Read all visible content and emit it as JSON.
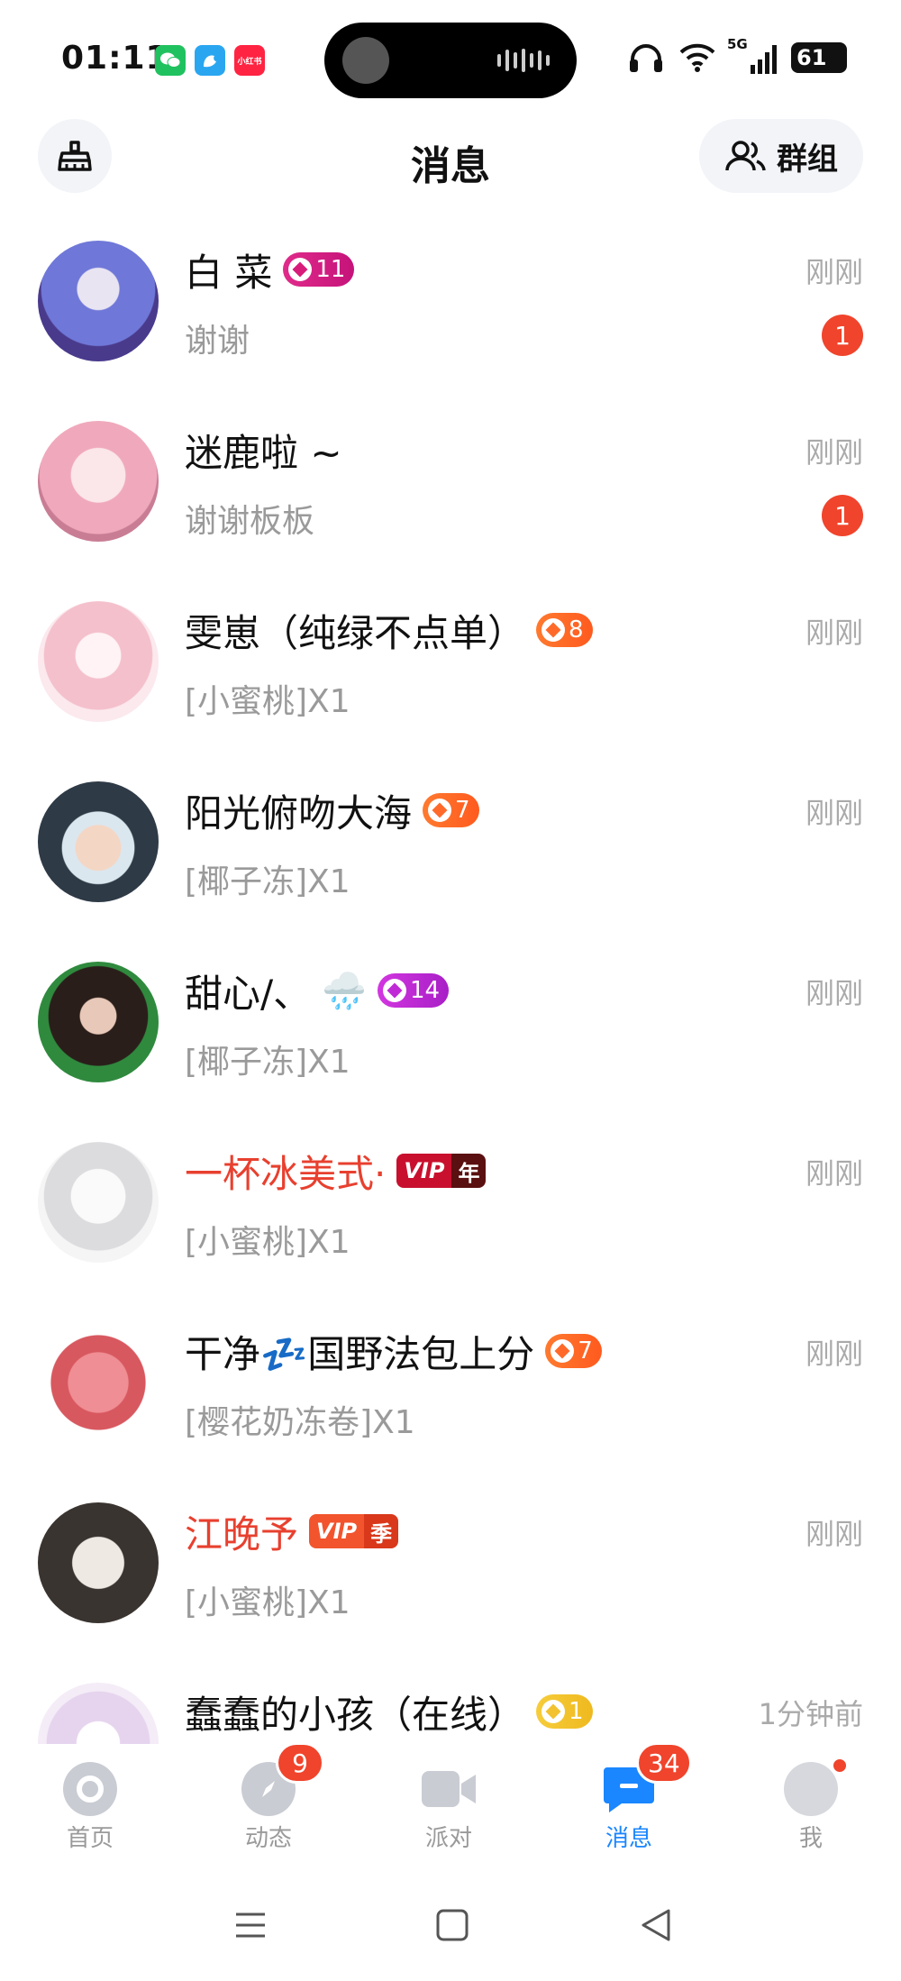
{
  "status_bar": {
    "time": "01:11",
    "apps": [
      {
        "icon": "wechat-icon",
        "color": "#20c25f"
      },
      {
        "icon": "bird-app-icon",
        "color": "#2aa6f0"
      },
      {
        "icon": "xiaohongshu-icon",
        "color": "#ff2442",
        "label": "小红书"
      }
    ],
    "network": "5G",
    "battery": "61"
  },
  "header": {
    "title": "消息",
    "group_label": "群组"
  },
  "conversations": [
    {
      "name": "白 菜",
      "level": "11",
      "level_color": "#d81b7a",
      "preview": "谢谢",
      "time": "刚刚",
      "unread": "1",
      "avatar_color": "#5a74d6"
    },
    {
      "name": "迷鹿啦 ~",
      "preview": "谢谢板板",
      "time": "刚刚",
      "unread": "1",
      "avatar_color": "#f2b9c8"
    },
    {
      "name": "雯崽（纯绿不点单）",
      "level": "8",
      "level_color": "#ff6a2a",
      "preview": "[小蜜桃]X1",
      "time": "刚刚",
      "avatar_color": "#f7d7de"
    },
    {
      "name": "阳光俯吻大海",
      "level": "7",
      "level_color": "#ff6a2a",
      "preview": "[椰子冻]X1",
      "time": "刚刚",
      "avatar_color": "#3a4a5a"
    },
    {
      "name": "甜心/、",
      "emoji": "🌧️",
      "level": "14",
      "level_color": "#c02ad6",
      "preview": "[椰子冻]X1",
      "time": "刚刚",
      "avatar_color": "#2f7a3a"
    },
    {
      "name": "一杯冰美式·",
      "vip": "VIP",
      "vip_term": "年",
      "vip_color": "#c8102e",
      "vip_term_color": "#5a1010",
      "preview": "[小蜜桃]X1",
      "time": "刚刚",
      "avatar_color": "#e9e9ea"
    },
    {
      "name": "干净💤国野法包上分",
      "level": "7",
      "level_color": "#ff6a2a",
      "preview": "[樱花奶冻卷]X1",
      "time": "刚刚",
      "avatar_color": "#e5737a"
    },
    {
      "name": "江晚予",
      "vip": "VIP",
      "vip_term": "季",
      "vip_color": "#f2542d",
      "vip_term_color": "#d9381b",
      "preview": "[小蜜桃]X1",
      "time": "刚刚",
      "avatar_color": "#3b3b3b"
    },
    {
      "name": "蠢蠢的小孩（在线）",
      "level": "1",
      "level_color": "#f2c230",
      "preview": "",
      "time": "1分钟前",
      "avatar_color": "#efe3f3"
    }
  ],
  "tabs": [
    {
      "label": "首页",
      "icon": "home-icon"
    },
    {
      "label": "动态",
      "icon": "compass-icon",
      "badge": "9"
    },
    {
      "label": "派对",
      "icon": "video-icon"
    },
    {
      "label": "消息",
      "icon": "message-icon",
      "badge": "34",
      "active": true
    },
    {
      "label": "我",
      "icon": "profile-icon",
      "dot": true
    }
  ],
  "colors": {
    "accent": "#1a86ff",
    "badge_red": "#f0442c",
    "vip_name": "#e8402f"
  }
}
